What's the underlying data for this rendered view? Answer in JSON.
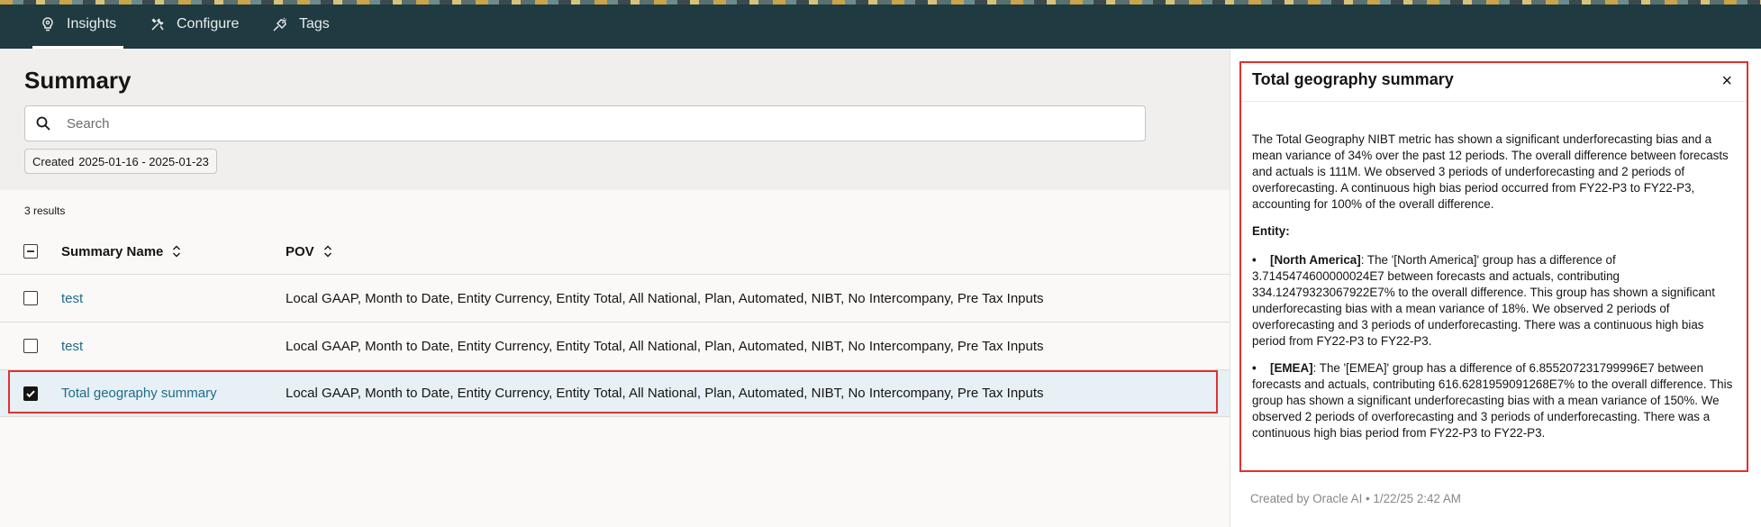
{
  "nav": {
    "tabs": [
      {
        "label": "Insights",
        "icon": "lightbulb-icon",
        "active": true
      },
      {
        "label": "Configure",
        "icon": "tools-icon",
        "active": false
      },
      {
        "label": "Tags",
        "icon": "tag-icon",
        "active": false
      }
    ]
  },
  "summary": {
    "title": "Summary",
    "search_placeholder": "Search",
    "filter_chip_label": "Created",
    "filter_chip_value": "2025-01-16 - 2025-01-23",
    "results_count": "3 results",
    "columns": {
      "name": "Summary Name",
      "pov": "POV"
    },
    "rows": [
      {
        "name": "test",
        "pov": "Local GAAP, Month to Date, Entity Currency, Entity Total, All National, Plan, Automated, NIBT, No Intercompany, Pre Tax Inputs",
        "checked": false
      },
      {
        "name": "test",
        "pov": "Local GAAP, Month to Date, Entity Currency, Entity Total, All National, Plan, Automated, NIBT, No Intercompany, Pre Tax Inputs",
        "checked": false
      },
      {
        "name": "Total geography summary",
        "pov": "Local GAAP, Month to Date, Entity Currency, Entity Total, All National, Plan, Automated, NIBT, No Intercompany, Pre Tax Inputs",
        "checked": true
      }
    ]
  },
  "panel": {
    "title": "Total geography summary",
    "close_label": "×",
    "intro": "The Total Geography NIBT metric has shown a significant underforecasting bias and a mean variance of 34% over the past 12 periods. The overall difference between forecasts and actuals is 111M. We observed 3 periods of underforecasting and 2 periods of overforecasting. A continuous high bias period occurred from FY22-P3 to FY22-P3, accounting for 100% of the overall difference.",
    "entity_heading": "Entity:",
    "entities": [
      {
        "label": "[North America]",
        "text": ": The '[North America]' group has a difference of 3.7145474600000024E7 between forecasts and actuals, contributing 334.12479323067922E7% to the overall difference. This group has shown a significant underforecasting bias with a mean variance of 18%. We observed 2 periods of overforecasting and 3 periods of underforecasting. There was a continuous high bias period from FY22-P3 to FY22-P3."
      },
      {
        "label": "[EMEA]",
        "text": ": The '[EMEA]' group has a difference of 6.855207231799996E7 between forecasts and actuals, contributing 616.6281959091268E7% to the overall difference. This group has shown a significant underforecasting bias with a mean variance of 150%. We observed 2 periods of overforecasting and 3 periods of underforecasting. There was a continuous high bias period from FY22-P3 to FY22-P3."
      }
    ],
    "footer": "Created by Oracle AI • 1/22/25 2:42 AM"
  },
  "colors": {
    "topbar": "#1f3a40",
    "link": "#1f6b8c",
    "highlight_outline": "#e03131",
    "selected_row": "#e6f0f5"
  }
}
